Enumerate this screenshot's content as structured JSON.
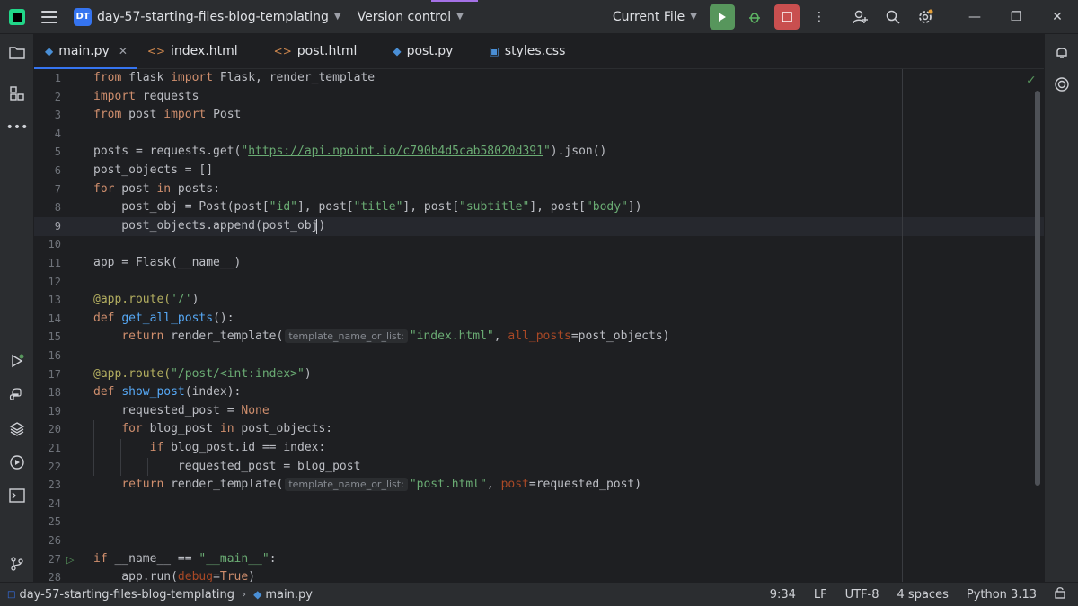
{
  "titlebar": {
    "project_badge": "DT",
    "project_name": "day-57-starting-files-blog-templating",
    "vcs_label": "Version control",
    "run_config": "Current File"
  },
  "tabs": [
    {
      "label": "main.py",
      "icon": "python-file-icon",
      "active": true
    },
    {
      "label": "index.html",
      "icon": "html-file-icon",
      "active": false
    },
    {
      "label": "post.html",
      "icon": "html-file-icon",
      "active": false
    },
    {
      "label": "post.py",
      "icon": "python-file-icon",
      "active": false
    },
    {
      "label": "styles.css",
      "icon": "css-file-icon",
      "active": false
    }
  ],
  "editor": {
    "current_line": 9,
    "line_numbers": [
      "1",
      "2",
      "3",
      "4",
      "5",
      "6",
      "7",
      "8",
      "9",
      "10",
      "11",
      "12",
      "13",
      "14",
      "15",
      "16",
      "17",
      "18",
      "19",
      "20",
      "21",
      "22",
      "23",
      "24",
      "25",
      "26",
      "27",
      "28"
    ],
    "lines": {
      "l1": [
        "from",
        " flask ",
        "import",
        " Flask, render_template"
      ],
      "l2": [
        "import",
        " requests"
      ],
      "l3": [
        "from",
        " post ",
        "import",
        " Post"
      ],
      "l5": [
        "posts = requests.get(",
        "\"",
        "https://api.npoint.io/c790b4d5cab58020d391",
        "\"",
        ").json()"
      ],
      "l6": "post_objects = []",
      "l7": [
        "for",
        " post ",
        "in",
        " posts:"
      ],
      "l8": [
        "    post_obj = Post(post[",
        "\"id\"",
        "], post[",
        "\"title\"",
        "], post[",
        "\"subtitle\"",
        "], post[",
        "\"body\"",
        "])"
      ],
      "l9": "    post_objects.append(post_obj)",
      "l11": "app = Flask(__name__)",
      "l13": [
        "@app.route(",
        "'/'",
        ")"
      ],
      "l14": [
        "def",
        " ",
        "get_all_posts",
        "():"
      ],
      "l15": [
        "    ",
        "return",
        " render_template(",
        "template_name_or_list:",
        "\"index.html\"",
        ", ",
        "all_posts",
        "=post_objects)"
      ],
      "l17": [
        "@app.route(",
        "\"/post/<int:index>\"",
        ")"
      ],
      "l18": [
        "def",
        " ",
        "show_post",
        "(index):"
      ],
      "l19": [
        "    requested_post = ",
        "None"
      ],
      "l20": [
        "    ",
        "for",
        " blog_post ",
        "in",
        " post_objects:"
      ],
      "l21": [
        "        ",
        "if",
        " blog_post.id == index:"
      ],
      "l22": "            requested_post = blog_post",
      "l23": [
        "    ",
        "return",
        " render_template(",
        "template_name_or_list:",
        "\"post.html\"",
        ", ",
        "post",
        "=requested_post)"
      ],
      "l27": [
        "if",
        " __name__ == ",
        "\"__main__\"",
        ":"
      ],
      "l28": [
        "    app.run(",
        "debug",
        "=",
        "True",
        ")"
      ]
    }
  },
  "statusbar": {
    "breadcrumb_project": "day-57-starting-files-blog-templating",
    "breadcrumb_file": "main.py",
    "position": "9:34",
    "line_sep": "LF",
    "encoding": "UTF-8",
    "indent": "4 spaces",
    "interpreter": "Python 3.13"
  },
  "colors": {
    "accent": "#3574f0",
    "run": "#57965c",
    "stop": "#c94f4f",
    "keyword": "#cf8e6d",
    "string": "#6aab73"
  }
}
